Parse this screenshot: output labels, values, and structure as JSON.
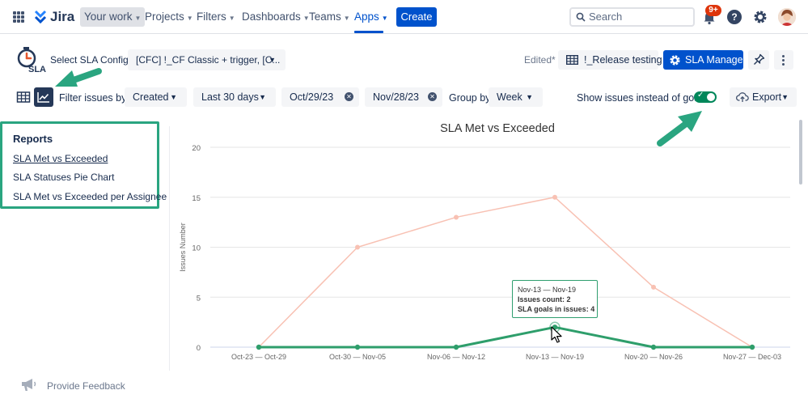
{
  "topnav": {
    "logo_text": "Jira",
    "your_work": "Your work",
    "projects": "Projects",
    "filters": "Filters",
    "dashboards": "Dashboards",
    "teams": "Teams",
    "apps": "Apps",
    "create": "Create",
    "search_placeholder": "Search",
    "notifications_badge": "9+"
  },
  "header": {
    "sla_logo_text": "SLA",
    "select_config_label": "Select SLA Config:",
    "config_value": "[CFC] !_CF Classic + trigger, [C...",
    "edited": "Edited*",
    "release_button": "!_Release testing",
    "sla_manager_button": "SLA Manager"
  },
  "filters": {
    "filter_label": "Filter issues by:",
    "created": "Created",
    "range": "Last 30 days",
    "date_from": "Oct/29/23",
    "date_to": "Nov/28/23",
    "group_by_label": "Group by",
    "group_by_value": "Week",
    "toggle_label": "Show issues instead of goals",
    "export": "Export"
  },
  "reports": {
    "title": "Reports",
    "items": [
      "SLA Met vs Exceeded",
      "SLA Statuses Pie Chart",
      "SLA Met vs Exceeded per Assignee"
    ]
  },
  "tooltip": {
    "range": "Nov-13 — Nov-19",
    "count": "Issues count: 2",
    "goals": "SLA goals in issues: 4"
  },
  "feedback": "Provide Feedback",
  "colors": {
    "met": "#2e9e6b",
    "exceeded": "#f8c1b3",
    "accent": "#0052cc",
    "annotation": "#2aa580"
  },
  "chart_data": {
    "type": "line",
    "title": "SLA Met vs Exceeded",
    "xlabel": "",
    "ylabel": "Issues Number",
    "categories": [
      "Oct-23 — Oct-29",
      "Oct-30 — Nov-05",
      "Nov-06 — Nov-12",
      "Nov-13 — Nov-19",
      "Nov-20 — Nov-26",
      "Nov-27 — Dec-03"
    ],
    "yticks": [
      0,
      5,
      10,
      15,
      20
    ],
    "ylim": [
      0,
      20
    ],
    "grid": true,
    "series": [
      {
        "values": [
          0,
          10,
          13,
          15,
          6,
          0
        ],
        "color": "#f8c1b3"
      },
      {
        "values": [
          0,
          0,
          0,
          2,
          0,
          0
        ],
        "color": "#2e9e6b"
      }
    ]
  }
}
